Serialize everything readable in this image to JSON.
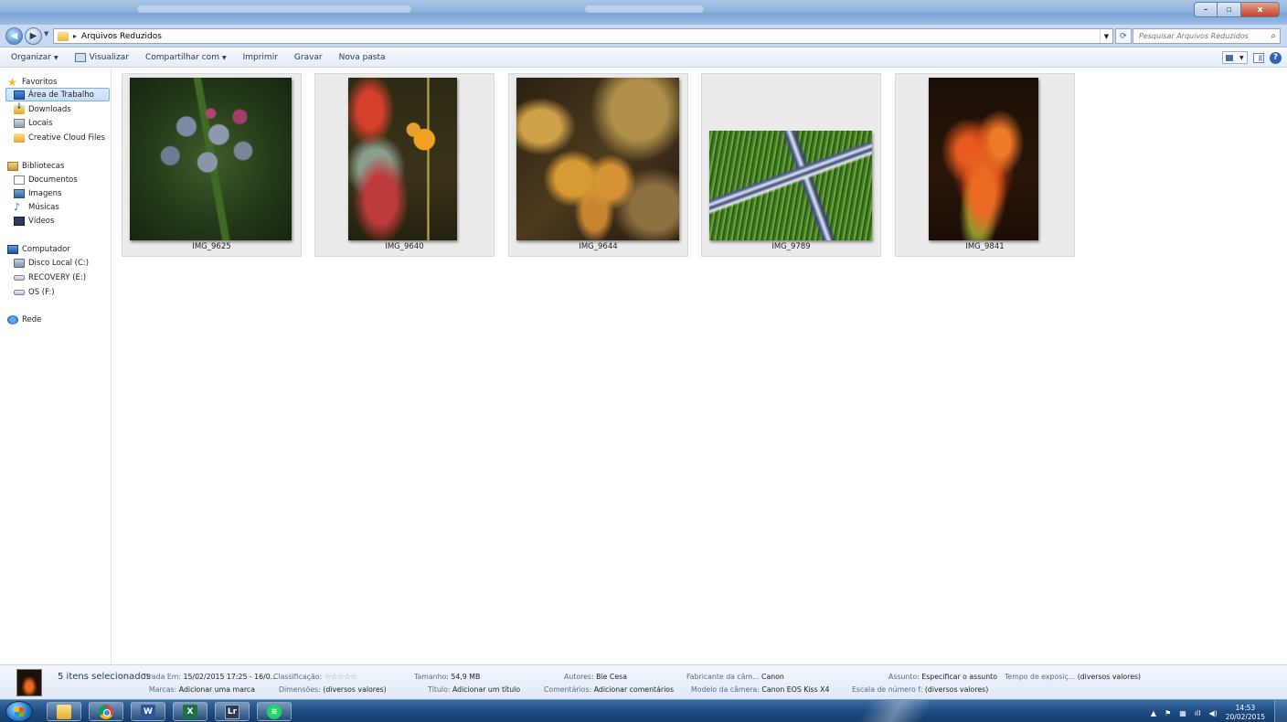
{
  "window": {
    "minimize": "–",
    "maximize": "▫",
    "close": "x"
  },
  "address": {
    "crumb": "Arquivos Reduzidos",
    "search_placeholder": "Pesquisar Arquivos Reduzidos"
  },
  "toolbar": {
    "organize": "Organizar",
    "view": "Visualizar",
    "share": "Compartilhar com",
    "print": "Imprimir",
    "burn": "Gravar",
    "new_folder": "Nova pasta",
    "help": "?"
  },
  "nav": {
    "favorites": "Favoritos",
    "desktop": "Área de Trabalho",
    "downloads": "Downloads",
    "places": "Locais",
    "creative_cloud": "Creative Cloud Files",
    "libraries": "Bibliotecas",
    "documents": "Documentos",
    "images": "Imagens",
    "music": "Músicas",
    "videos": "Vídeos",
    "computer": "Computador",
    "drive_c": "Disco Local (C:)",
    "drive_e": "RECOVERY (E:)",
    "drive_f": "OS (F:)",
    "network": "Rede"
  },
  "files": [
    {
      "name": "IMG_9625"
    },
    {
      "name": "IMG_9640"
    },
    {
      "name": "IMG_9644"
    },
    {
      "name": "IMG_9789"
    },
    {
      "name": "IMG_9841"
    }
  ],
  "details": {
    "selected": "5 itens selecionados",
    "taken_label": "Tirada Em:",
    "taken_value": "15/02/2015 17:25 - 16/0...",
    "rating_label": "Classificação:",
    "rating_stars": "☆☆☆☆☆",
    "tags_label": "Marcas:",
    "tags_value": "Adicionar uma marca",
    "dimensions_label": "Dimensões:",
    "dimensions_value": "(diversos valores)",
    "size_label": "Tamanho:",
    "size_value": "54,9 MB",
    "title_label": "Título:",
    "title_value": "Adicionar um título",
    "authors_label": "Autores:",
    "authors_value": "Bie Cesa",
    "comments_label": "Comentários:",
    "comments_value": "Adicionar comentários",
    "maker_label": "Fabricante da câm...",
    "maker_value": "Canon",
    "model_label": "Modelo da câmera:",
    "model_value": "Canon EOS Kiss X4",
    "subject_label": "Assunto:",
    "subject_value": "Especificar o assunto",
    "fnumber_label": "Escala de número f:",
    "fnumber_value": "(diversos valores)",
    "exposure_label": "Tempo de exposiç...",
    "exposure_value": "(diversos valores)"
  },
  "taskbar": {
    "word": "W",
    "excel": "X",
    "lightroom": "Lr",
    "spotify": "≋",
    "time": "14:53",
    "date": "20/02/2015"
  }
}
